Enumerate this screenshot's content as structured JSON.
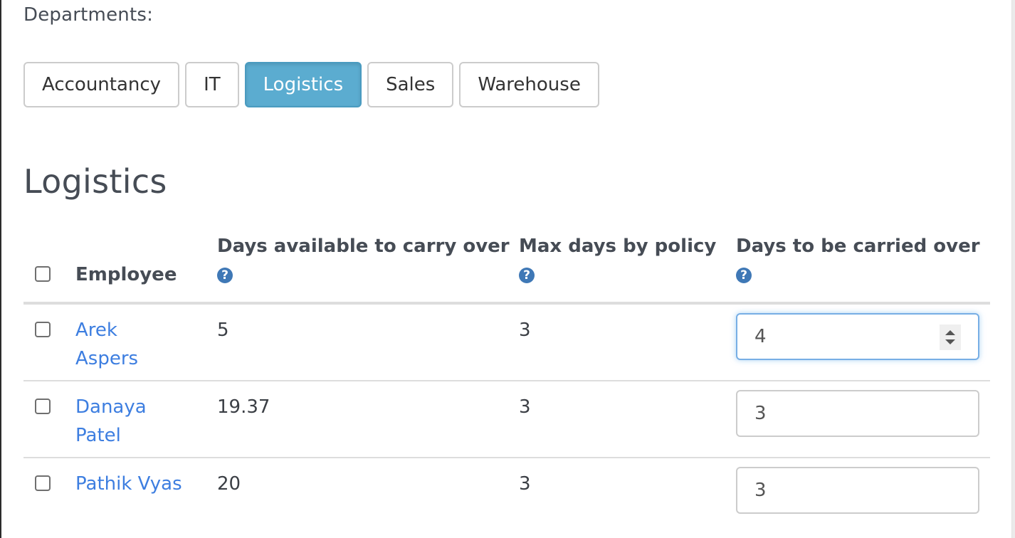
{
  "departments": {
    "label": "Departments:",
    "buttons": [
      {
        "label": "Accountancy",
        "active": false
      },
      {
        "label": "IT",
        "active": false
      },
      {
        "label": "Logistics",
        "active": true
      },
      {
        "label": "Sales",
        "active": false
      },
      {
        "label": "Warehouse",
        "active": false
      }
    ],
    "active_color": "#5bacd0"
  },
  "section": {
    "title": "Logistics"
  },
  "table": {
    "headers": {
      "employee": "Employee",
      "days_available": "Days available to carry over",
      "max_days": "Max days by policy",
      "days_to_carry": "Days to be carried over",
      "help_icon": "?"
    },
    "rows": [
      {
        "employee": "Arek Aspers",
        "days_available": "5",
        "max_days": "3",
        "days_to_carry": "4",
        "focused": true
      },
      {
        "employee": "Danaya Patel",
        "days_available": "19.37",
        "max_days": "3",
        "days_to_carry": "3",
        "focused": false
      },
      {
        "employee": "Pathik Vyas",
        "days_available": "20",
        "max_days": "3",
        "days_to_carry": "3",
        "focused": false
      }
    ]
  },
  "colors": {
    "link": "#3d7ee0",
    "help_icon": "#3f78b6",
    "focus_border": "#77aee5"
  }
}
